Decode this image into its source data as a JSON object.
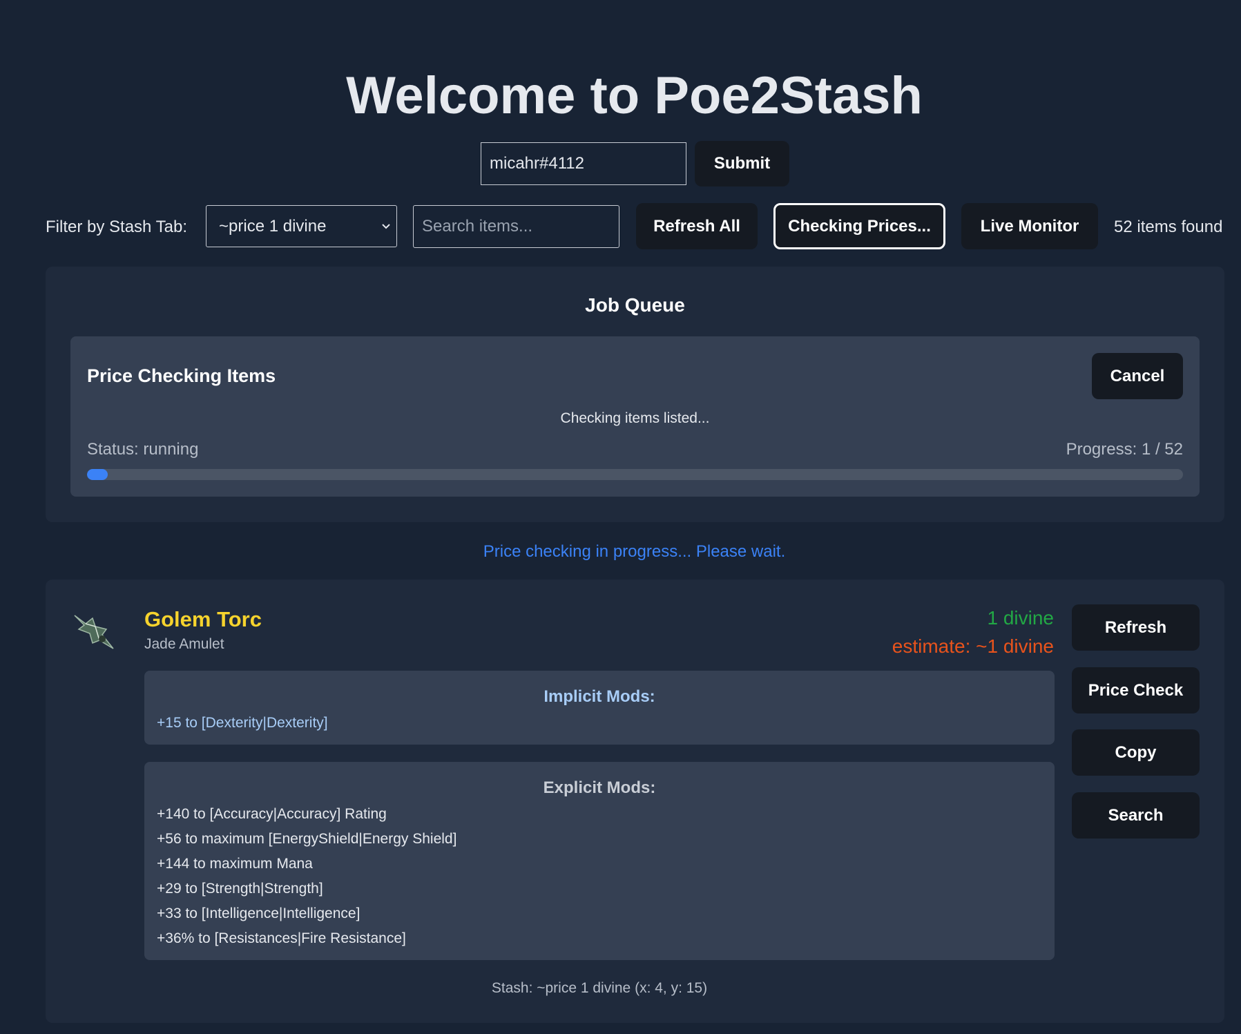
{
  "header": {
    "title": "Welcome to Poe2Stash",
    "account_value": "micahr#4112",
    "submit_label": "Submit"
  },
  "toolbar": {
    "filter_label": "Filter by Stash Tab:",
    "stash_tab_selected": "~price 1 divine",
    "search_placeholder": "Search items...",
    "refresh_all_label": "Refresh All",
    "checking_prices_label": "Checking Prices...",
    "live_monitor_label": "Live Monitor",
    "items_found": "52 items found"
  },
  "job_queue": {
    "title": "Job Queue",
    "job": {
      "title": "Price Checking Items",
      "cancel_label": "Cancel",
      "message": "Checking items listed...",
      "status": "Status: running",
      "progress": "Progress: 1 / 52",
      "progress_fraction": 0.019
    }
  },
  "notice": "Price checking in progress... Please wait.",
  "item": {
    "name": "Golem Torc",
    "base": "Jade Amulet",
    "price": "1 divine",
    "estimate": "estimate: ~1 divine",
    "implicit_title": "Implicit Mods:",
    "implicit_mods": [
      "+15 to [Dexterity|Dexterity]"
    ],
    "explicit_title": "Explicit Mods:",
    "explicit_mods": [
      "+140 to [Accuracy|Accuracy] Rating",
      "+56 to maximum [EnergyShield|Energy Shield]",
      "+144 to maximum Mana",
      "+29 to [Strength|Strength]",
      "+33 to [Intelligence|Intelligence]",
      "+36% to [Resistances|Fire Resistance]"
    ],
    "stash_location": "Stash: ~price 1 divine (x: 4, y: 15)",
    "actions": {
      "refresh": "Refresh",
      "price_check": "Price Check",
      "copy": "Copy",
      "search": "Search"
    }
  },
  "colors": {
    "background": "#182334",
    "panel": "#1f2a3c",
    "item_name": "#f6d32d",
    "price": "#22a845",
    "estimate": "#e8531c",
    "notice": "#3b82f6",
    "progress_fill": "#3b82f6"
  }
}
